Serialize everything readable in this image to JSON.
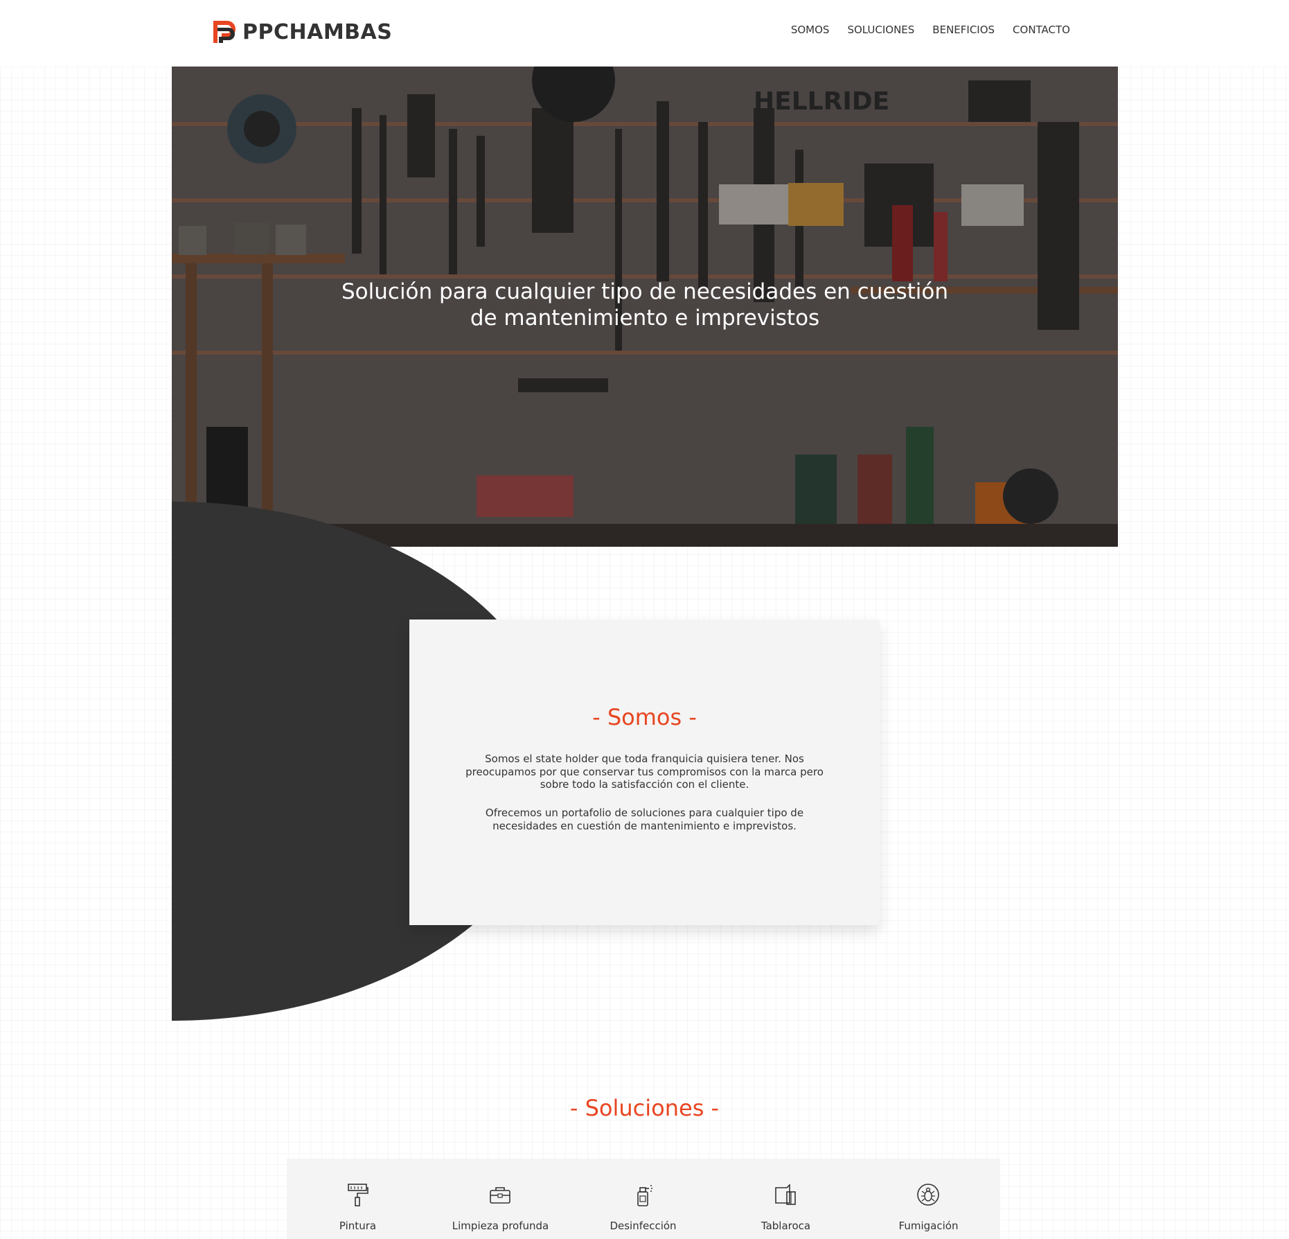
{
  "brand": {
    "name": "PPCHAMBAS",
    "logo_icon": "pp-logo-icon",
    "accent_color": "#e84521",
    "dark_color": "#333333"
  },
  "nav": {
    "items": [
      "SOMOS",
      "SOLUCIONES",
      "BENEFICIOS",
      "CONTACTO"
    ]
  },
  "hero": {
    "title_line1": "Solución para cualquier tipo de necesidades en cuestión",
    "title_line2": "de mantenimiento e imprevistos",
    "image_sign_text": "HELLRIDE"
  },
  "somos": {
    "title": "- Somos -",
    "paragraph1": "Somos el state holder que toda franquicia quisiera tener. Nos preocupamos por que conservar tus compromisos con la marca pero sobre todo la satisfacción con el cliente.",
    "paragraph2": "Ofrecemos un portafolio de soluciones para cualquier tipo de necesidades en cuestión de mantenimiento e imprevistos."
  },
  "soluciones": {
    "title": "- Soluciones -",
    "items": [
      {
        "label": "Pintura",
        "icon": "paint-roller-icon"
      },
      {
        "label": "Limpieza profunda",
        "icon": "cleaning-kit-icon"
      },
      {
        "label": "Desinfección",
        "icon": "spray-bottle-icon"
      },
      {
        "label": "Tablaroca",
        "icon": "drywall-icon"
      },
      {
        "label": "Fumigación",
        "icon": "bug-icon"
      }
    ]
  }
}
